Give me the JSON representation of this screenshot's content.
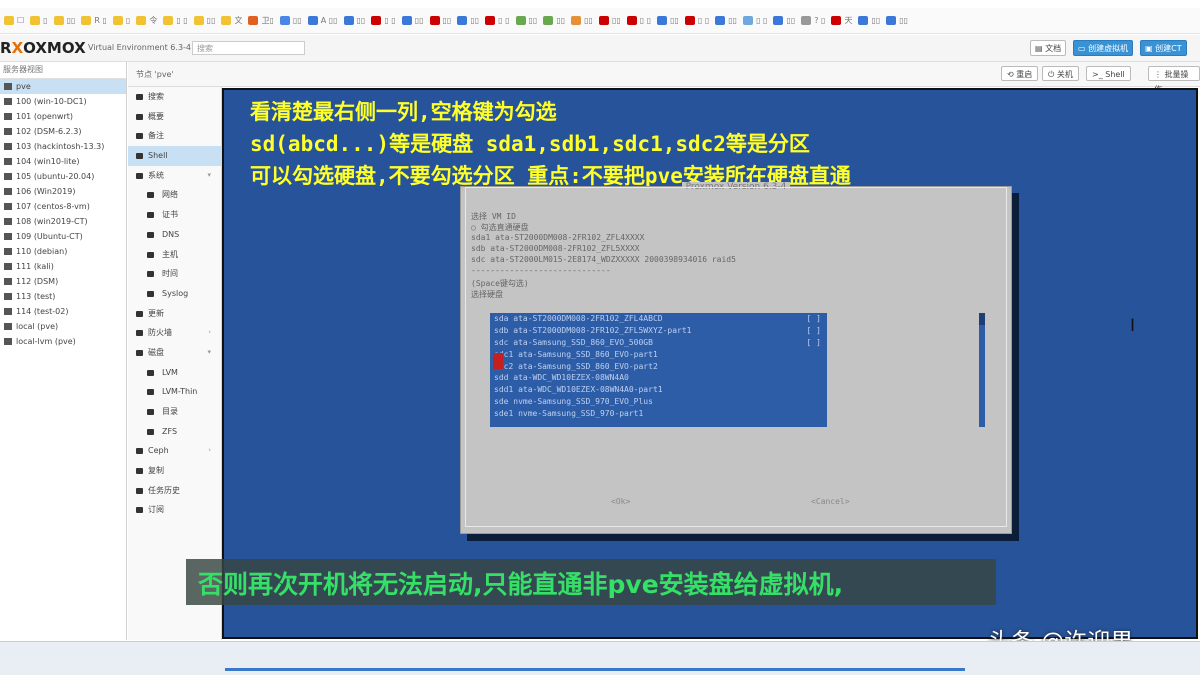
{
  "bookmarks": [
    {
      "label": "☐",
      "color": "#f1c232"
    },
    {
      "label": "▯",
      "color": "#f1c232"
    },
    {
      "label": "▯▯",
      "color": "#f1c232"
    },
    {
      "label": "R ▯",
      "color": "#f1c232"
    },
    {
      "label": "▯",
      "color": "#f1c232"
    },
    {
      "label": "令",
      "color": "#f1c232"
    },
    {
      "label": "▯ ▯",
      "color": "#f1c232"
    },
    {
      "label": "▯▯",
      "color": "#f1c232"
    },
    {
      "label": "文",
      "color": "#f1c232"
    },
    {
      "label": "卫▯",
      "color": "#e06020"
    },
    {
      "label": "▯▯",
      "color": "#4a86e8"
    },
    {
      "label": "A ▯▯",
      "color": "#3c78d8"
    },
    {
      "label": "▯▯",
      "color": "#3c78d8"
    },
    {
      "label": "▯ ▯",
      "color": "#cc0000"
    },
    {
      "label": "▯▯",
      "color": "#3c78d8"
    },
    {
      "label": "▯▯",
      "color": "#cc0000"
    },
    {
      "label": "▯▯",
      "color": "#3c78d8"
    },
    {
      "label": "▯ ▯",
      "color": "#cc0000"
    },
    {
      "label": "▯▯",
      "color": "#6aa84f"
    },
    {
      "label": "▯▯",
      "color": "#6aa84f"
    },
    {
      "label": "▯▯",
      "color": "#e69138"
    },
    {
      "label": "▯▯",
      "color": "#cc0000"
    },
    {
      "label": "▯ ▯",
      "color": "#cc0000"
    },
    {
      "label": "▯▯",
      "color": "#3c78d8"
    },
    {
      "label": "▯ ▯",
      "color": "#cc0000"
    },
    {
      "label": "▯▯",
      "color": "#3c78d8"
    },
    {
      "label": "▯ ▯",
      "color": "#6fa8dc"
    },
    {
      "label": "▯▯",
      "color": "#3c78d8"
    },
    {
      "label": "? ▯",
      "color": "#999999"
    },
    {
      "label": "天",
      "color": "#cc0000"
    },
    {
      "label": "▯▯",
      "color": "#3c78d8"
    },
    {
      "label": "▯▯",
      "color": "#3c78d8"
    }
  ],
  "header": {
    "logo_prefix": "R",
    "logo_x": "OXMOX",
    "version": "Virtual Environment 6.3-4",
    "search_placeholder": "搜索",
    "doc_button": "文档",
    "create_vm_button": "创建虚拟机",
    "create_ct_button": "创建CT"
  },
  "tree": {
    "view_label": "服务器视图",
    "items": [
      {
        "label": "pve",
        "selected": true
      },
      {
        "label": "100 (win-10-DC1)"
      },
      {
        "label": "101 (openwrt)"
      },
      {
        "label": "102 (DSM-6.2.3)"
      },
      {
        "label": "103 (hackintosh-13.3)"
      },
      {
        "label": "104 (win10-lite)"
      },
      {
        "label": "105 (ubuntu-20.04)"
      },
      {
        "label": "106 (Win2019)"
      },
      {
        "label": "107 (centos-8-vm)"
      },
      {
        "label": "108 (win2019-CT)"
      },
      {
        "label": "109 (Ubuntu-CT)"
      },
      {
        "label": "110 (debian)"
      },
      {
        "label": "111 (kali)"
      },
      {
        "label": "112 (DSM)"
      },
      {
        "label": "113 (test)"
      },
      {
        "label": "114 (test-02)"
      },
      {
        "label": "local (pve)"
      },
      {
        "label": "local-lvm (pve)"
      }
    ]
  },
  "breadcrumb": {
    "title": "节点 'pve'",
    "buttons": [
      "重启",
      "关机",
      "Shell",
      "批量操作"
    ]
  },
  "menu": {
    "items": [
      {
        "label": "搜索"
      },
      {
        "label": "概要"
      },
      {
        "label": "备注"
      },
      {
        "label": "Shell",
        "selected": true
      },
      {
        "label": "系统",
        "caret": "▾"
      },
      {
        "label": "网络",
        "sub": true
      },
      {
        "label": "证书",
        "sub": true
      },
      {
        "label": "DNS",
        "sub": true
      },
      {
        "label": "主机",
        "sub": true
      },
      {
        "label": "时间",
        "sub": true
      },
      {
        "label": "Syslog",
        "sub": true
      },
      {
        "label": "更新"
      },
      {
        "label": "防火墙",
        "caret": "›"
      },
      {
        "label": "磁盘",
        "caret": "▾"
      },
      {
        "label": "LVM",
        "sub": true
      },
      {
        "label": "LVM-Thin",
        "sub": true
      },
      {
        "label": "目录",
        "sub": true
      },
      {
        "label": "ZFS",
        "sub": true
      },
      {
        "label": "Ceph",
        "caret": "›"
      },
      {
        "label": "复制"
      },
      {
        "label": "任务历史"
      },
      {
        "label": "订阅"
      }
    ]
  },
  "console": {
    "annotations": [
      "看清楚最右侧一列,空格键为勾选",
      "sd(abcd...)等是硬盘 sda1,sdb1,sdc1,sdc2等是分区",
      "可以勾选硬盘,不要勾选分区 重点:不要把pve安装所在硬盘直通"
    ],
    "dialog": {
      "title": "Proxmox Version 6.3-4",
      "lines": [
        "选择 VM ID",
        "○ 勾选直通硬盘",
        "sda1  ata-ST2000DM008-2FR102_ZFL4XXXX",
        "sdb   ata-ST2000DM008-2FR102_ZFL5XXXX",
        "sdc   ata-ST2000LM015-2E8174_WDZXXXXX  2000398934016  raid5",
        "-----------------------------",
        "(Space键勾选)",
        "选择硬盘"
      ],
      "rows": [
        {
          "text": "sda  ata-ST2000DM008-2FR102_ZFL4ABCD",
          "mark": "[ ]"
        },
        {
          "text": "sdb  ata-ST2000DM008-2FR102_ZFL5WXYZ-part1",
          "mark": "[ ]"
        },
        {
          "text": "sdc  ata-Samsung_SSD_860_EVO_500GB",
          "mark": "[ ]"
        },
        {
          "text": "sdc1 ata-Samsung_SSD_860_EVO-part1",
          "mark": ""
        },
        {
          "text": "sdc2 ata-Samsung_SSD_860_EVO-part2",
          "mark": ""
        },
        {
          "text": "sdd  ata-WDC_WD10EZEX-08WN4A0",
          "mark": ""
        },
        {
          "text": "sdd1 ata-WDC_WD10EZEX-08WN4A0-part1",
          "mark": ""
        },
        {
          "text": "sde  nvme-Samsung_SSD_970_EVO_Plus",
          "mark": ""
        },
        {
          "text": "sde1 nvme-Samsung_SSD_970-part1",
          "mark": ""
        }
      ],
      "ok_button": "<Ok>",
      "cancel_button": "<Cancel>"
    }
  },
  "subtitle": "否则再次开机将无法启动,只能直通非pve安装盘给虚拟机,",
  "watermark": "头条 @许迎果"
}
